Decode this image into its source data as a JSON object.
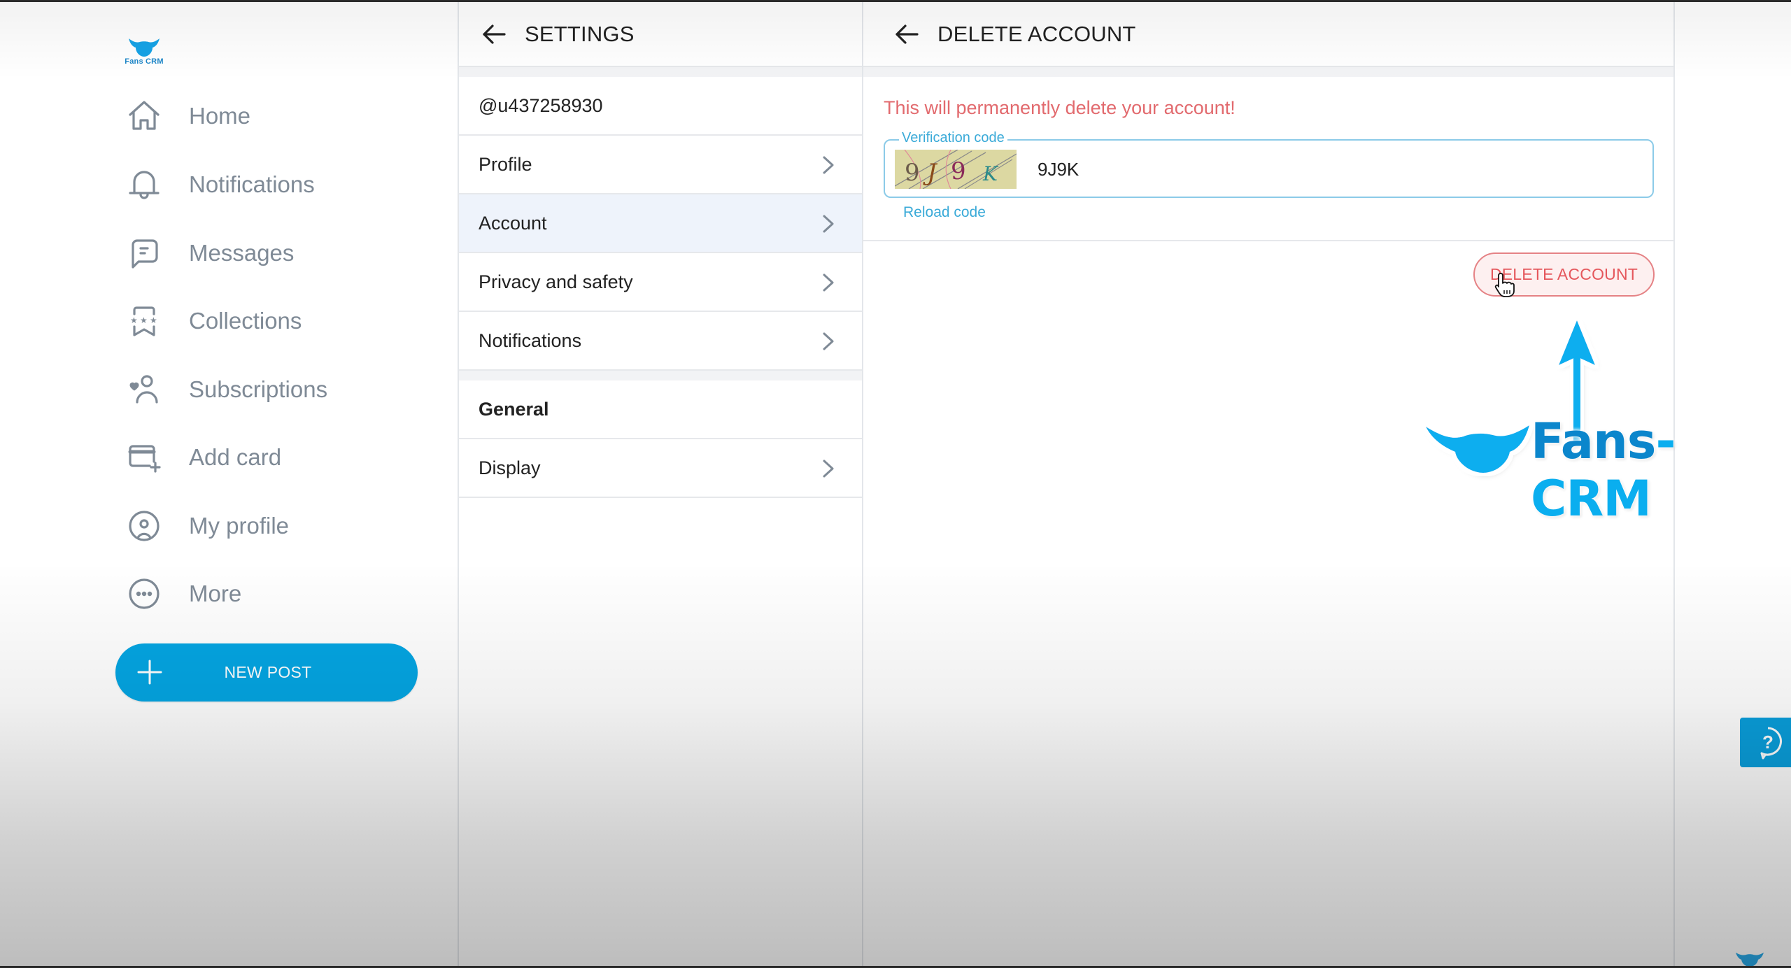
{
  "brand": {
    "logo_text": "Fans CRM",
    "accent_color": "#04a5e2",
    "danger_color": "#e26a6e"
  },
  "sidebar": {
    "items": [
      {
        "label": "Home",
        "icon": "home-icon"
      },
      {
        "label": "Notifications",
        "icon": "bell-icon"
      },
      {
        "label": "Messages",
        "icon": "message-icon"
      },
      {
        "label": "Collections",
        "icon": "collections-icon"
      },
      {
        "label": "Subscriptions",
        "icon": "subscriptions-icon"
      },
      {
        "label": "Add card",
        "icon": "add-card-icon"
      },
      {
        "label": "My profile",
        "icon": "profile-icon"
      },
      {
        "label": "More",
        "icon": "more-icon"
      }
    ],
    "new_post_label": "NEW POST"
  },
  "settings": {
    "title": "SETTINGS",
    "username": "@u437258930",
    "account_items": [
      {
        "label": "Profile"
      },
      {
        "label": "Account",
        "active": true
      },
      {
        "label": "Privacy and safety"
      },
      {
        "label": "Notifications"
      }
    ],
    "general_heading": "General",
    "general_items": [
      {
        "label": "Display"
      }
    ]
  },
  "delete_account": {
    "title": "DELETE ACCOUNT",
    "warning": "This will permanently delete your account!",
    "field_label": "Verification code",
    "captcha_chars": [
      "9",
      "J",
      "9",
      "K"
    ],
    "field_value": "9J9K",
    "reload_label": "Reload code",
    "delete_button_label": "DELETE ACCOUNT"
  },
  "watermark": {
    "text_fans": "Fans",
    "text_crm": "-CRM"
  }
}
